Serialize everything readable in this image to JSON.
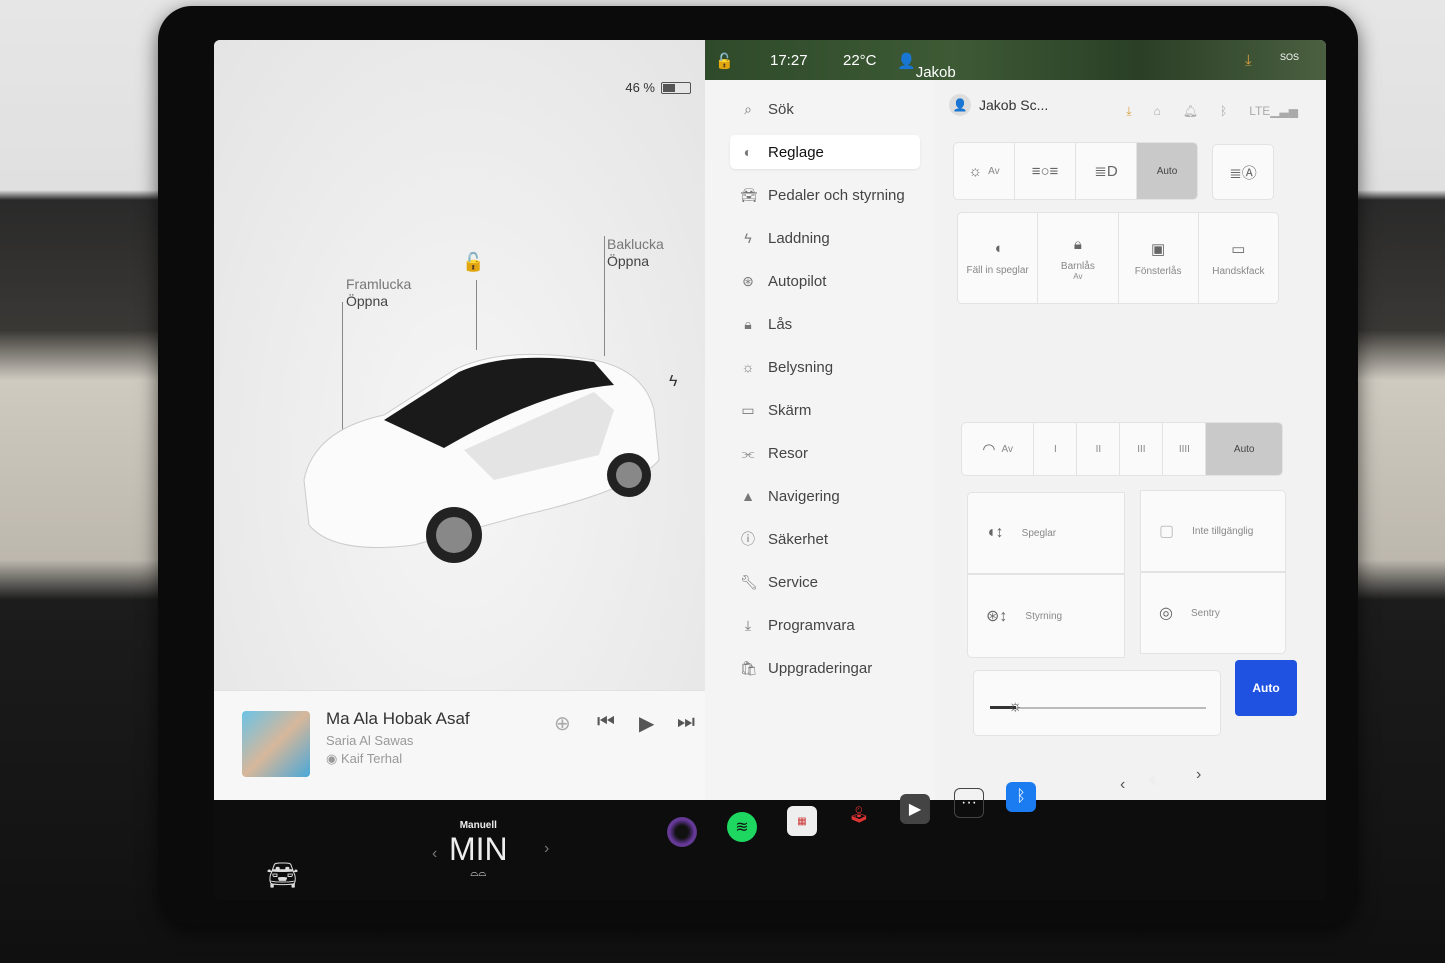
{
  "status": {
    "battery_percent": 46,
    "battery_label": "46 %",
    "time": "17:27",
    "temperature": "22°C",
    "driver": "Jakob Schw..."
  },
  "car_panel": {
    "frunk": {
      "title": "Framlucka",
      "action": "Öppna"
    },
    "trunk": {
      "title": "Baklucka",
      "action": "Öppna"
    },
    "lock_icon": "unlocked-padlock-icon",
    "charge_icon": "lightning-icon"
  },
  "media": {
    "title": "Ma Ala Hobak Asaf",
    "artist": "Saria Al Sawas",
    "album": "Kaif Terhal"
  },
  "menu": {
    "search": "Sök",
    "items": [
      {
        "label": "Reglage",
        "icon": "toggle-icon",
        "active": true
      },
      {
        "label": "Pedaler och styrning",
        "icon": "car-icon"
      },
      {
        "label": "Laddning",
        "icon": "lightning-icon"
      },
      {
        "label": "Autopilot",
        "icon": "steering-wheel-icon"
      },
      {
        "label": "Lås",
        "icon": "lock-icon"
      },
      {
        "label": "Belysning",
        "icon": "sun-icon"
      },
      {
        "label": "Skärm",
        "icon": "display-icon"
      },
      {
        "label": "Resor",
        "icon": "trips-icon"
      },
      {
        "label": "Navigering",
        "icon": "navigation-icon"
      },
      {
        "label": "Säkerhet",
        "icon": "info-icon"
      },
      {
        "label": "Service",
        "icon": "wrench-icon"
      },
      {
        "label": "Programvara",
        "icon": "download-icon"
      },
      {
        "label": "Uppgraderingar",
        "icon": "bag-icon"
      }
    ]
  },
  "controls": {
    "user": "Jakob Sc...",
    "lights": {
      "off": "Av",
      "auto": "Auto",
      "selected": "Auto"
    },
    "buttons": [
      {
        "label": "Fäll in speglar"
      },
      {
        "label": "Barnlås",
        "sub": "Av"
      },
      {
        "label": "Fönsterlås"
      },
      {
        "label": "Handskfack"
      }
    ],
    "wipers": {
      "off": "Av",
      "levels": [
        "I",
        "II",
        "III",
        "IIII"
      ],
      "auto": "Auto",
      "selected": "Auto"
    },
    "tiles": {
      "mirrors": "Speglar",
      "unavailable": "Inte tillgänglig",
      "steering": "Styrning",
      "sentry": "Sentry"
    },
    "brightness_percent": 12,
    "brightness_auto": "Auto"
  },
  "dock": {
    "climate_mode": "Manuell",
    "fan": "MIN",
    "apps": [
      "camera-icon",
      "spotify-icon",
      "calendar-icon",
      "joystick-icon",
      "video-icon",
      "more-icon",
      "bluetooth-icon"
    ],
    "volume": "muted"
  },
  "colors": {
    "accent": "#1f52e0",
    "spotify": "#1ed760",
    "bluetooth": "#1a7cf0"
  }
}
